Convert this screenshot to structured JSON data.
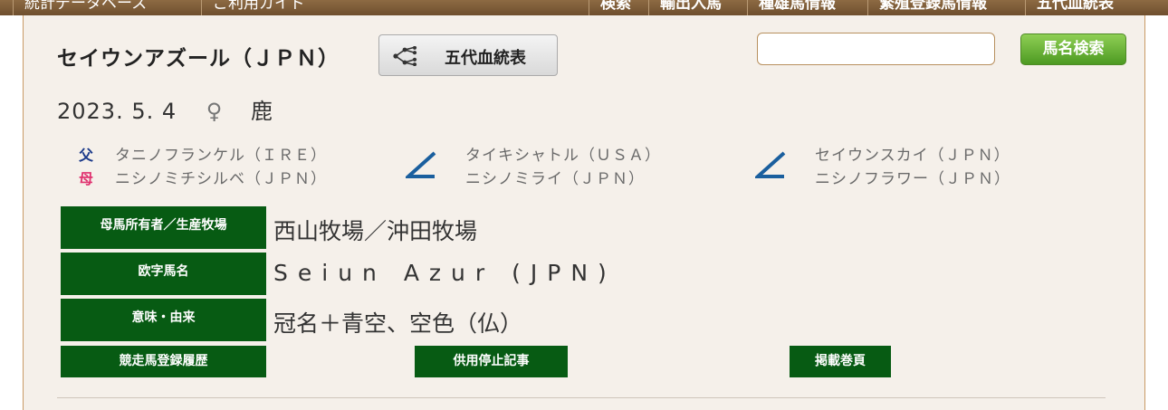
{
  "topnav": {
    "items": [
      "統計データベース",
      "ご利用ガイド",
      "検索",
      "輸出入馬",
      "種雄馬情報",
      "繁殖登録馬情報",
      "五代血統表"
    ]
  },
  "horse": {
    "name": "セイウンアズール（ＪＰＮ）",
    "birth_date": "2023. 5. 4",
    "sex_symbol": "♀",
    "coat_color": "鹿"
  },
  "pedigree_button": {
    "label": "五代血統表",
    "icon": "pedigree-tree-icon"
  },
  "search": {
    "value": "",
    "button_label": "馬名検索"
  },
  "pedigree": {
    "sire_tag": "父",
    "dam_tag": "母",
    "sire": "タニノフランケル（ＩＲＥ）",
    "dam": "ニシノミチシルベ（ＪＰＮ）",
    "sire_sire": "タイキシャトル（ＵＳＡ）",
    "sire_dam": "ニシノミライ（ＪＰＮ）",
    "dam_sire": "セイウンスカイ（ＪＰＮ）",
    "dam_dam": "ニシノフラワー（ＪＰＮ）"
  },
  "info": {
    "owner_label": "母馬所有者／生産牧場",
    "owner_value": "西山牧場／沖田牧場",
    "roman_label": "欧字馬名",
    "roman_value": "Seiun Azur (JPN)",
    "meaning_label": "意味・由来",
    "meaning_value": "冠名＋青空、空色（仏）"
  },
  "links": {
    "registration_history": "競走馬登録履歴",
    "retirement_article": "供用停止記事",
    "published_page": "掲載巻頁"
  },
  "colors": {
    "nav_brown": "#7a5a36",
    "panel_bg": "#f5f0ea",
    "label_green": "#075b13",
    "search_green": "#5aa62c",
    "sire_blue": "#1b3a8a",
    "dam_pink": "#e0316f",
    "slash_blue": "#1a5f9e"
  }
}
